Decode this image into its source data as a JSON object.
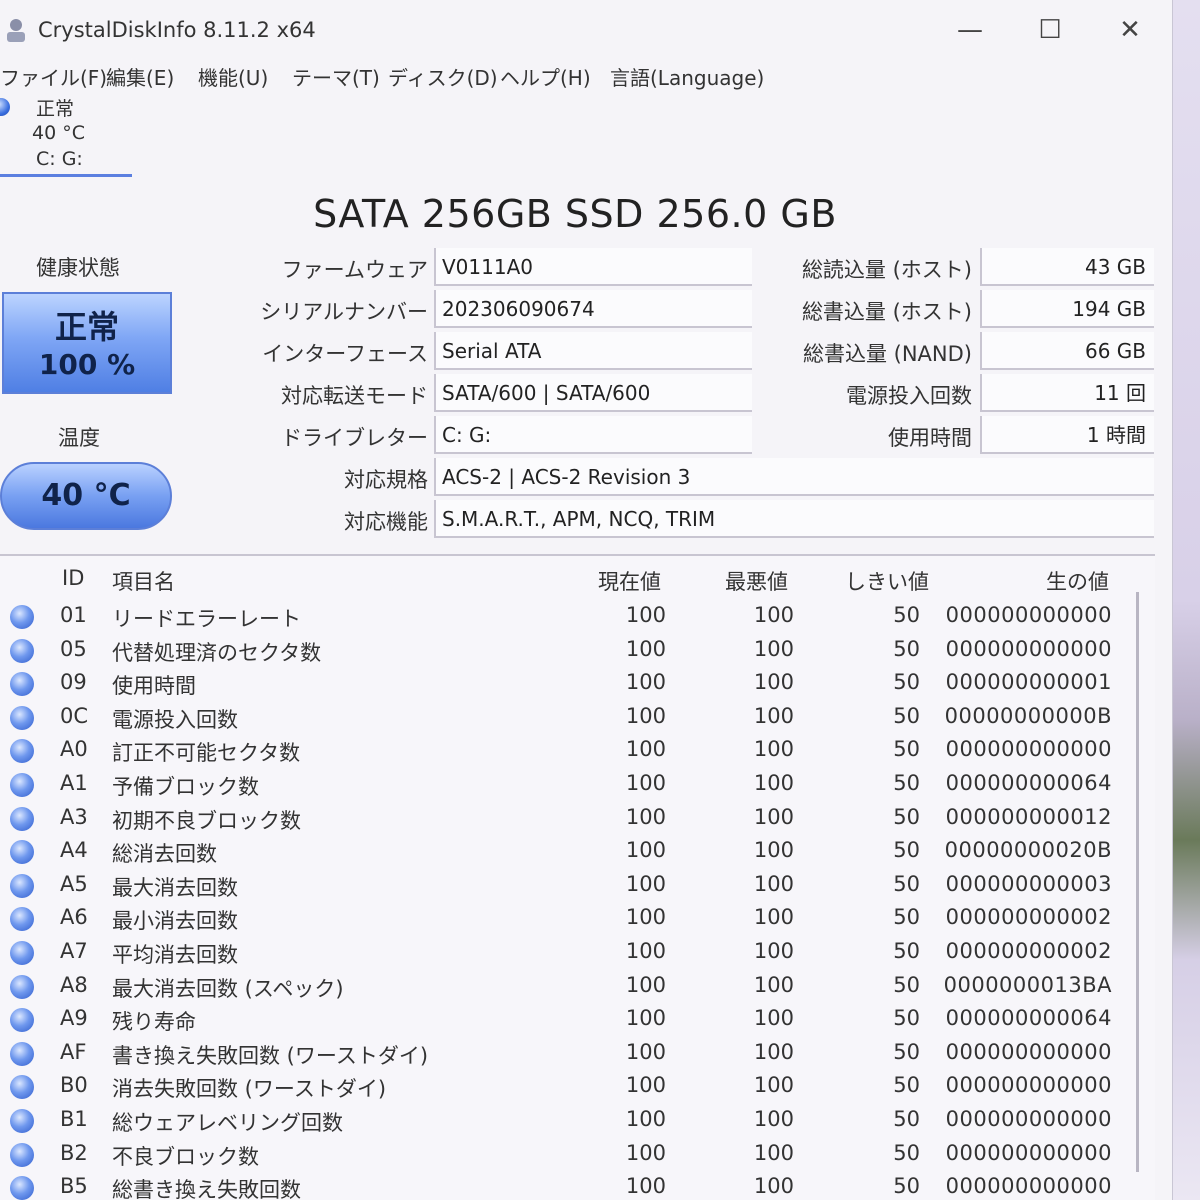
{
  "window": {
    "title": "CrystalDiskInfo 8.11.2 x64",
    "minimize": "—",
    "maximize": "☐",
    "close": "✕"
  },
  "menu": [
    "ファイル(F)",
    "編集(E)",
    "機能(U)",
    "テーマ(T)",
    "ディスク(D)",
    "ヘルプ(H)",
    "言語(Language)"
  ],
  "disk_tab": {
    "status": "正常",
    "temp": "40 °C",
    "drives": "C: G:"
  },
  "model": "SATA 256GB SSD 256.0 GB",
  "health": {
    "label": "健康状態",
    "status": "正常",
    "percent": "100 %",
    "color": "#5b85e6"
  },
  "temperature": {
    "label": "温度",
    "value": "40 °C"
  },
  "fields": {
    "firmware": {
      "label": "ファームウェア",
      "value": "V0111A0"
    },
    "serial": {
      "label": "シリアルナンバー",
      "value": "202306090674"
    },
    "interface": {
      "label": "インターフェース",
      "value": "Serial ATA"
    },
    "transfer": {
      "label": "対応転送モード",
      "value": "SATA/600 | SATA/600"
    },
    "drive_letter": {
      "label": "ドライブレター",
      "value": "C: G:"
    },
    "standard": {
      "label": "対応規格",
      "value": "ACS-2 | ACS-2 Revision 3"
    },
    "features": {
      "label": "対応機能",
      "value": "S.M.A.R.T., APM, NCQ, TRIM"
    }
  },
  "stats": {
    "host_reads": {
      "label": "総読込量 (ホスト)",
      "value": "43 GB"
    },
    "host_writes": {
      "label": "総書込量 (ホスト)",
      "value": "194 GB"
    },
    "nand_writes": {
      "label": "総書込量 (NAND)",
      "value": "66 GB"
    },
    "power_count": {
      "label": "電源投入回数",
      "value": "11 回"
    },
    "power_hours": {
      "label": "使用時間",
      "value": "1 時間"
    }
  },
  "table": {
    "headers": {
      "id": "ID",
      "name": "項目名",
      "current": "現在値",
      "worst": "最悪値",
      "threshold": "しきい値",
      "raw": "生の値"
    },
    "rows": [
      {
        "id": "01",
        "name": "リードエラーレート",
        "current": "100",
        "worst": "100",
        "threshold": "50",
        "raw": "000000000000"
      },
      {
        "id": "05",
        "name": "代替処理済のセクタ数",
        "current": "100",
        "worst": "100",
        "threshold": "50",
        "raw": "000000000000"
      },
      {
        "id": "09",
        "name": "使用時間",
        "current": "100",
        "worst": "100",
        "threshold": "50",
        "raw": "000000000001"
      },
      {
        "id": "0C",
        "name": "電源投入回数",
        "current": "100",
        "worst": "100",
        "threshold": "50",
        "raw": "00000000000B"
      },
      {
        "id": "A0",
        "name": "訂正不可能セクタ数",
        "current": "100",
        "worst": "100",
        "threshold": "50",
        "raw": "000000000000"
      },
      {
        "id": "A1",
        "name": "予備ブロック数",
        "current": "100",
        "worst": "100",
        "threshold": "50",
        "raw": "000000000064"
      },
      {
        "id": "A3",
        "name": "初期不良ブロック数",
        "current": "100",
        "worst": "100",
        "threshold": "50",
        "raw": "000000000012"
      },
      {
        "id": "A4",
        "name": "総消去回数",
        "current": "100",
        "worst": "100",
        "threshold": "50",
        "raw": "00000000020B"
      },
      {
        "id": "A5",
        "name": "最大消去回数",
        "current": "100",
        "worst": "100",
        "threshold": "50",
        "raw": "000000000003"
      },
      {
        "id": "A6",
        "name": "最小消去回数",
        "current": "100",
        "worst": "100",
        "threshold": "50",
        "raw": "000000000002"
      },
      {
        "id": "A7",
        "name": "平均消去回数",
        "current": "100",
        "worst": "100",
        "threshold": "50",
        "raw": "000000000002"
      },
      {
        "id": "A8",
        "name": "最大消去回数 (スペック)",
        "current": "100",
        "worst": "100",
        "threshold": "50",
        "raw": "0000000013BA"
      },
      {
        "id": "A9",
        "name": "残り寿命",
        "current": "100",
        "worst": "100",
        "threshold": "50",
        "raw": "000000000064"
      },
      {
        "id": "AF",
        "name": "書き換え失敗回数 (ワーストダイ)",
        "current": "100",
        "worst": "100",
        "threshold": "50",
        "raw": "000000000000"
      },
      {
        "id": "B0",
        "name": "消去失敗回数 (ワーストダイ)",
        "current": "100",
        "worst": "100",
        "threshold": "50",
        "raw": "000000000000"
      },
      {
        "id": "B1",
        "name": "総ウェアレベリング回数",
        "current": "100",
        "worst": "100",
        "threshold": "50",
        "raw": "000000000000"
      },
      {
        "id": "B2",
        "name": "不良ブロック数",
        "current": "100",
        "worst": "100",
        "threshold": "50",
        "raw": "000000000000"
      },
      {
        "id": "B5",
        "name": "総書き換え失敗回数",
        "current": "100",
        "worst": "100",
        "threshold": "50",
        "raw": "000000000000"
      }
    ]
  }
}
